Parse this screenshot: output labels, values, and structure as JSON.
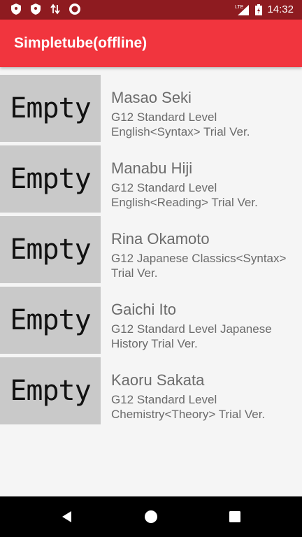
{
  "status_bar": {
    "time": "14:32",
    "network_label": "LTE",
    "left_icons": [
      "shield-icon",
      "shield-icon",
      "data-sync-icon",
      "record-icon"
    ],
    "right_icons": [
      "signal-icon",
      "battery-icon"
    ]
  },
  "app_bar": {
    "title": "Simpletube(offline)",
    "color": "#f1353e"
  },
  "list": {
    "items": [
      {
        "thumb": "Empty",
        "name": "Masao Seki",
        "desc": "G12 Standard Level English<Syntax> Trial Ver."
      },
      {
        "thumb": "Empty",
        "name": "Manabu Hiji",
        "desc": "G12 Standard Level English<Reading> Trial Ver."
      },
      {
        "thumb": "Empty",
        "name": "Rina Okamoto",
        "desc": "G12 Japanese Classics<Syntax> Trial Ver."
      },
      {
        "thumb": "Empty",
        "name": "Gaichi Ito",
        "desc": "G12 Standard Level Japanese History Trial Ver."
      },
      {
        "thumb": "Empty",
        "name": "Kaoru Sakata",
        "desc": "G12 Standard Level Chemistry<Theory> Trial Ver."
      }
    ]
  },
  "nav_bar": {
    "buttons": [
      "back-icon",
      "home-icon",
      "recents-icon"
    ]
  }
}
